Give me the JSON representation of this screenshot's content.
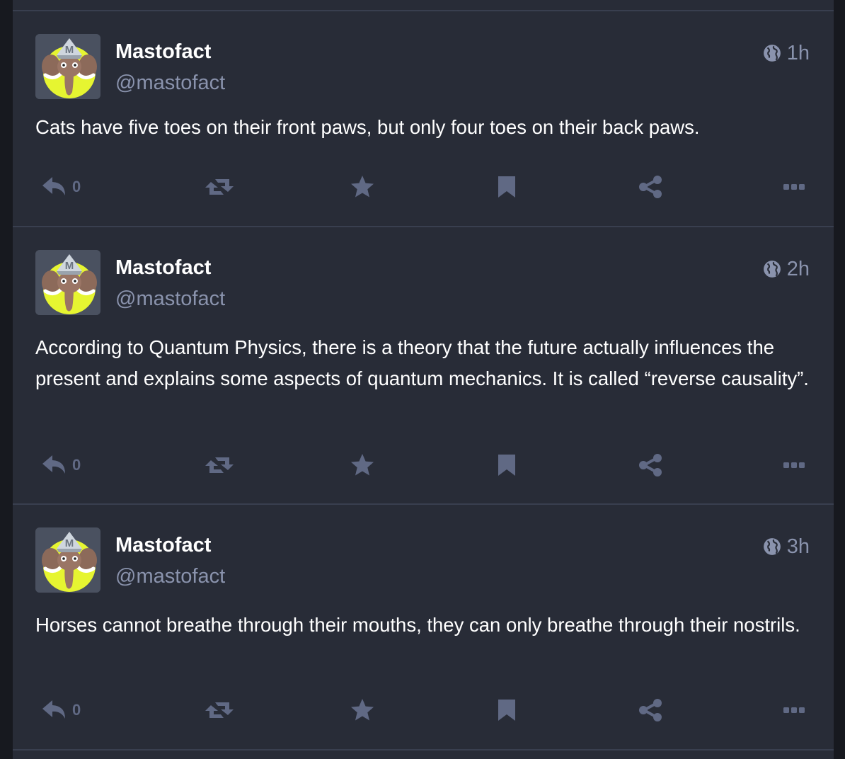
{
  "posts": [
    {
      "display_name": "Mastofact",
      "handle": "@mastofact",
      "time": "1h",
      "content": "Cats have five toes on their front paws, but only four toes on their back paws.",
      "reply_count": "0"
    },
    {
      "display_name": "Mastofact",
      "handle": "@mastofact",
      "time": "2h",
      "content": "According to Quantum Physics, there is a theory that the future actually influences the present and explains some aspects of quantum mechanics. It is called “reverse causality”.",
      "reply_count": "0"
    },
    {
      "display_name": "Mastofact",
      "handle": "@mastofact",
      "time": "3h",
      "content": "Horses cannot breathe through their mouths, they can only breathe through their nostrils.",
      "reply_count": "0"
    }
  ],
  "icons": {
    "visibility": "globe-icon",
    "reply": "reply-icon",
    "boost": "boost-icon",
    "favourite": "star-icon",
    "bookmark": "bookmark-icon",
    "share": "share-icon",
    "more": "more-icon"
  },
  "colors": {
    "page_background": "#17191f",
    "column_background": "#282c37",
    "divider": "#393f4f",
    "muted_text": "#8a93ad",
    "action_icon": "#606984",
    "avatar_accent": "#e6f531"
  }
}
